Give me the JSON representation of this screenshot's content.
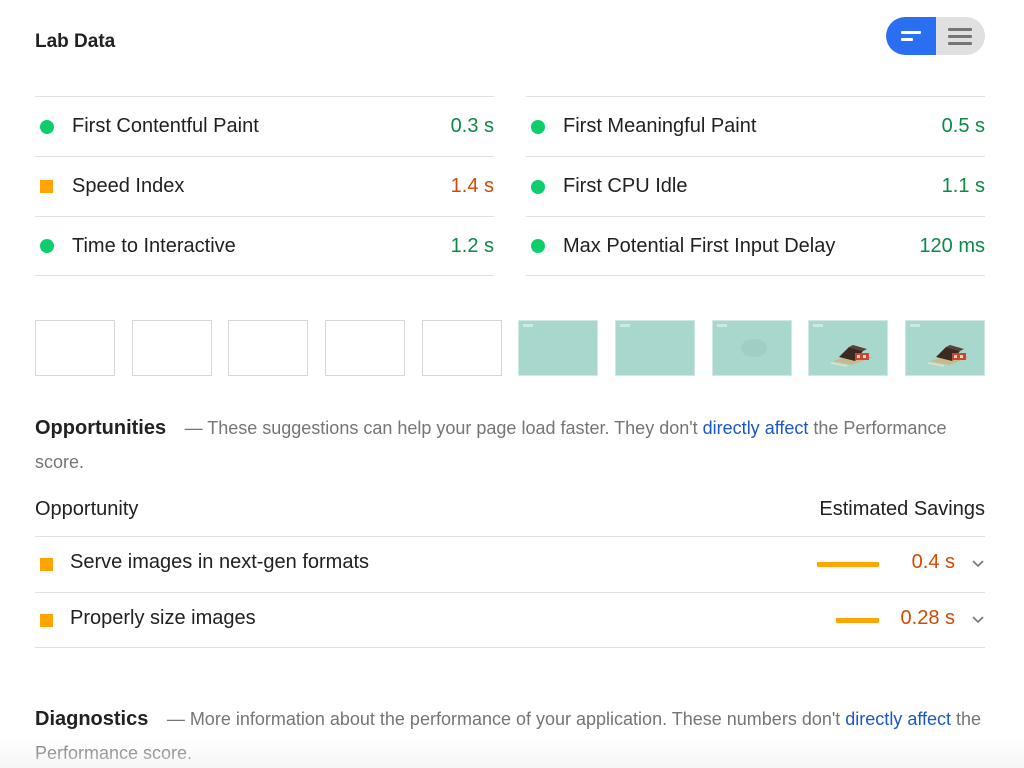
{
  "header": {
    "title": "Lab Data",
    "toggle": {
      "left_icon": "bars-short-icon",
      "right_icon": "bars-long-icon",
      "active": "left"
    }
  },
  "metrics": {
    "left": [
      {
        "label": "First Contentful Paint",
        "value": "0.3 s",
        "status": "pass"
      },
      {
        "label": "Speed Index",
        "value": "1.4 s",
        "status": "average"
      },
      {
        "label": "Time to Interactive",
        "value": "1.2 s",
        "status": "pass"
      }
    ],
    "right": [
      {
        "label": "First Meaningful Paint",
        "value": "0.5 s",
        "status": "pass"
      },
      {
        "label": "First CPU Idle",
        "value": "1.1 s",
        "status": "pass"
      },
      {
        "label": "Max Potential First Input Delay",
        "value": "120 ms",
        "status": "pass"
      }
    ]
  },
  "filmstrip": {
    "frames": [
      "blank",
      "blank",
      "blank",
      "blank",
      "blank",
      "teal",
      "teal",
      "teal-blur",
      "teal-house",
      "teal-house"
    ]
  },
  "opportunities": {
    "title": "Opportunities",
    "desc_prefix": "— These suggestions can help your page load faster. They don't ",
    "desc_link": "directly affect",
    "desc_suffix": " the Performance score.",
    "col_left": "Opportunity",
    "col_right": "Estimated Savings",
    "items": [
      {
        "label": "Serve images in next-gen formats",
        "value": "0.4 s",
        "fraction": 1.0
      },
      {
        "label": "Properly size images",
        "value": "0.28 s",
        "fraction": 0.7
      }
    ]
  },
  "diagnostics": {
    "title": "Diagnostics",
    "desc_prefix": "— More information about the performance of your application. These numbers don't ",
    "desc_link": "directly affect",
    "desc_suffix": " the Performance score."
  },
  "colors": {
    "pass": "#0cce6b",
    "average": "#ffa400",
    "link": "#1a57c8",
    "toggle_active": "#2a6ff2"
  }
}
